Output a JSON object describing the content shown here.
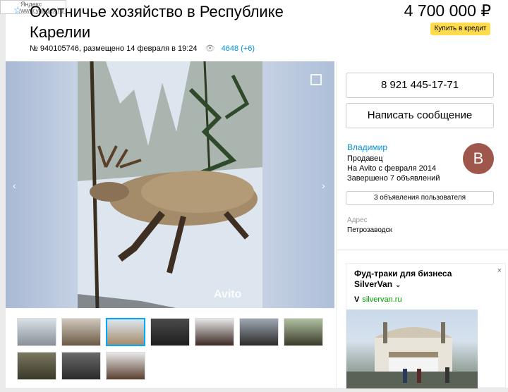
{
  "badge": {
    "line1": "Яндекс",
    "line2": "www.yandex.ru"
  },
  "listing": {
    "title_line1": "Охотничье хозяйство в Республике",
    "title_line2": "Карелии",
    "meta": "№ 940105746, размещено 14 февраля в 19:24",
    "views": "4648 (+6)",
    "price": "4 700 000 ₽",
    "credit_label": "Купить в кредит"
  },
  "gallery": {
    "watermark": "Avito",
    "thumbnail_count": 10,
    "selected_index": 2
  },
  "contact": {
    "phone": "8 921 445-17-71",
    "message_label": "Написать сообщение"
  },
  "seller": {
    "name": "Владимир",
    "role": "Продавец",
    "since": "На Avito с февраля 2014",
    "completed": "Завершено 7 объявлений",
    "avatar_letter": "В",
    "avatar_color": "#a0574b",
    "listings_button": "3 объявления пользователя"
  },
  "address": {
    "label": "Адрес",
    "value": "Петрозаводск"
  },
  "ad": {
    "title": "Фуд-траки для бизнеса SilverVan",
    "url": "silvervan.ru",
    "close": "×"
  },
  "colors": {
    "accent": "#0091d9",
    "credit": "#ffdb4d",
    "url": "#00a000"
  }
}
